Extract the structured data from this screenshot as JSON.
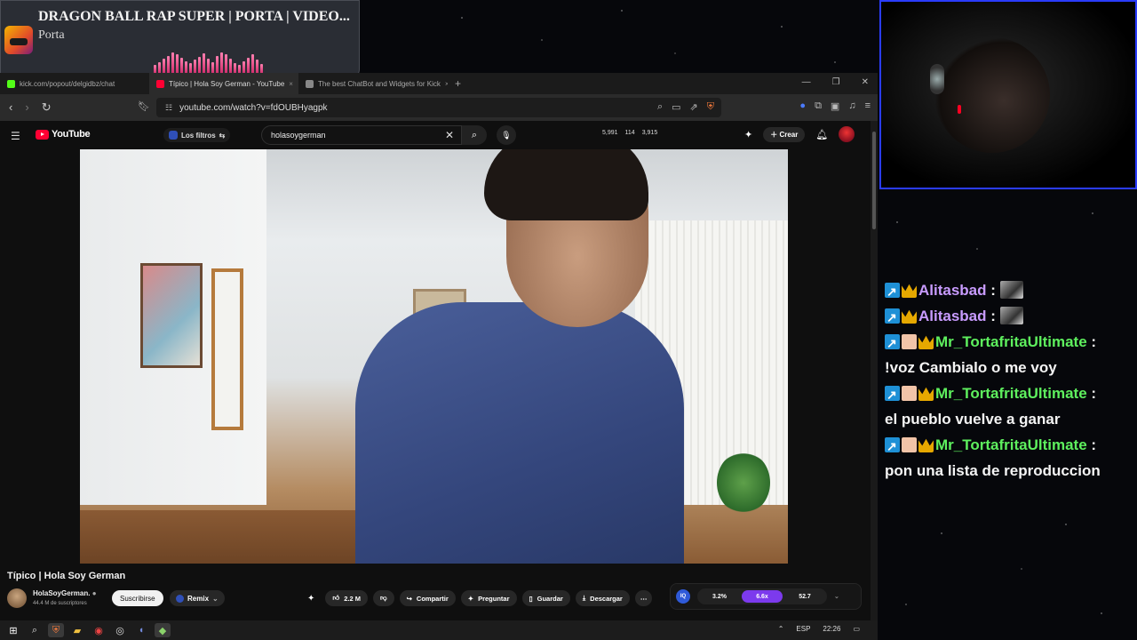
{
  "now_playing": {
    "title": "DRAGON BALL RAP SUPER | PORTA | VIDEO...",
    "artist": "Porta",
    "eq_levels": [
      0.4,
      0.55,
      0.7,
      0.85,
      1.0,
      0.9,
      0.75,
      0.6,
      0.5,
      0.65,
      0.8,
      0.95,
      0.7,
      0.55,
      0.85,
      1.0,
      0.9,
      0.7,
      0.5,
      0.4,
      0.6,
      0.75,
      0.9,
      0.65,
      0.45
    ]
  },
  "browser": {
    "tabs": [
      {
        "label": "kick.com/popout/delgidbz/chat",
        "color": "#53fc18"
      },
      {
        "label": "Típico | Hola Soy German - YouTube",
        "color": "#ff0033"
      },
      {
        "label": "The best ChatBot and Widgets for Kick",
        "color": "#888888"
      }
    ],
    "new_tab": "+",
    "url": "youtube.com/watch?v=fdOUBHyagpk"
  },
  "youtube": {
    "logo": "YouTube",
    "filters_label": "Los filtros",
    "search_value": "holasoygerman",
    "stats": [
      "5,991",
      "114",
      "3,915"
    ],
    "create_label": "Crear",
    "video_title": "Típico | Hola Soy German",
    "channel_name": "HolaSoyGerman.",
    "channel_subs": "44.4 M de suscriptores",
    "subscribe_label": "Suscribirse",
    "remix_label": "Remix",
    "actions": {
      "likes": "2.2 M",
      "share": "Compartir",
      "ask": "Preguntar",
      "save": "Guardar",
      "download": "Descargar"
    },
    "ext": {
      "iq": "IQ",
      "left": "3.2%",
      "mid": "6.6x",
      "right": "52.7"
    }
  },
  "taskbar": {
    "lang": "ESP",
    "time": "22:26"
  },
  "chat": {
    "messages": [
      {
        "user": "Alitasbad",
        "color": "purple",
        "text": "",
        "emote": true
      },
      {
        "user": "Alitasbad",
        "color": "purple",
        "text": "",
        "emote": true
      },
      {
        "user": "Mr_TortafritaUltimate",
        "color": "green",
        "text": "!voz Cambialo o me voy",
        "emote": false
      },
      {
        "user": "Mr_TortafritaUltimate",
        "color": "green",
        "text": "el pueblo vuelve a ganar",
        "emote": false
      },
      {
        "user": "Mr_TortafritaUltimate",
        "color": "green",
        "text": "pon una lista de reproduccion",
        "emote": false
      }
    ]
  }
}
